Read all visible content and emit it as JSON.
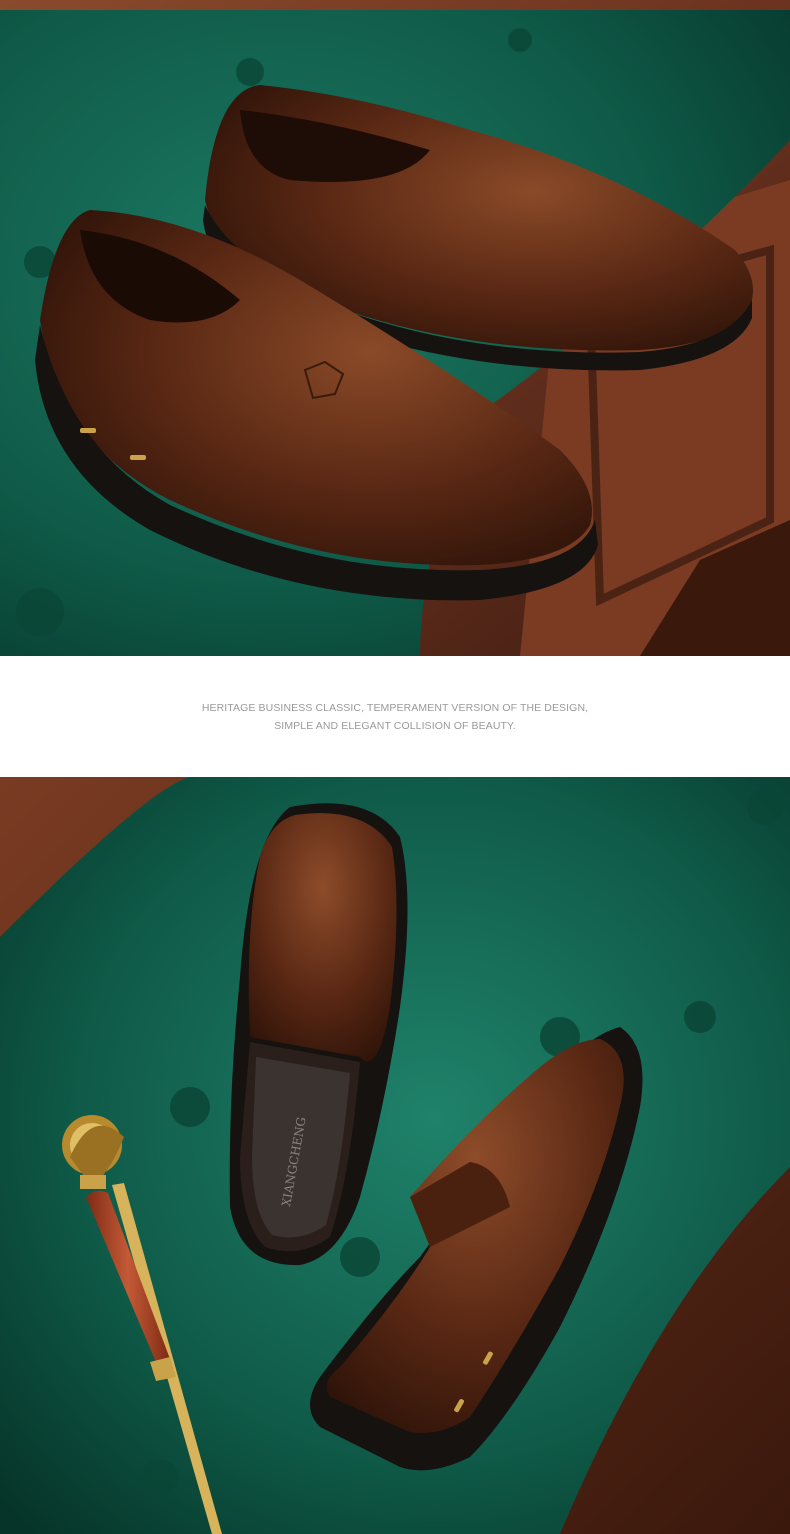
{
  "caption": {
    "line1": "HERITAGE BUSINESS CLASSIC, TEMPERAMENT VERSION OF THE DESIGN,",
    "line2": "SIMPLE AND ELEGANT COLLISION OF BEAUTY."
  },
  "insole_brand": "XIANGCHENG",
  "colors": {
    "velvet_green": "#0f5a48",
    "wood": "#6b3320",
    "leather_brown": "#5a2814",
    "sole_black": "#151210",
    "cane_red": "#b8482c",
    "cane_gold": "#c9a24a",
    "caption_text": "#9a9a9a"
  },
  "photos": [
    {
      "name": "top-photo",
      "subject": "pair of brown leather slip-on loafers on green velvet bench"
    },
    {
      "name": "bottom-photo",
      "subject": "brown leather loafers with walking cane on green velvet bench"
    }
  ]
}
